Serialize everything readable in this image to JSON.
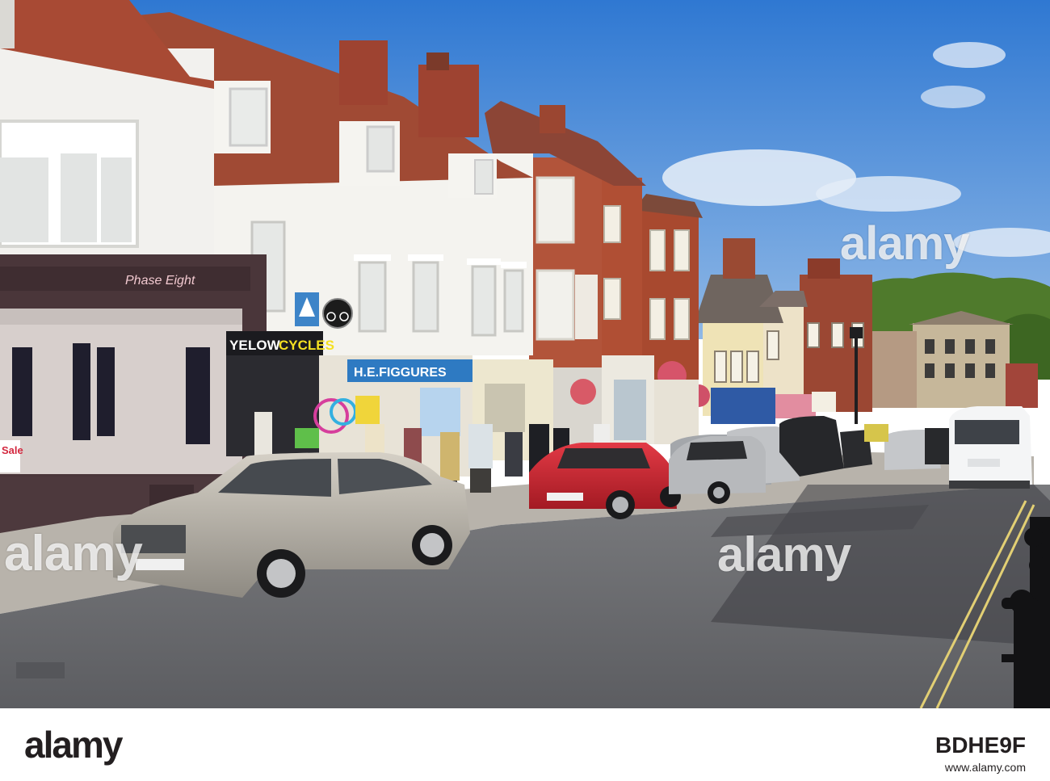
{
  "photo": {
    "shop_signs": {
      "phase_eight": "Phase Eight",
      "yellow_cycles_left": "YE",
      "yellow_cycles_mid": "LOW",
      "yellow_cycles_right": "CYCLES",
      "figgures": "H.E.FIGGURES",
      "sale": "Sale"
    },
    "watermarks": [
      "alamy",
      "alamy",
      "alamy",
      "alamy"
    ]
  },
  "footer": {
    "logo": "alamy",
    "image_id": "BDHE9F",
    "url": "www.alamy.com"
  },
  "colors": {
    "sky": "#3f86d8",
    "brick": "#a5442f",
    "road": "#6e6f72",
    "shopfront": "#4a363a"
  }
}
